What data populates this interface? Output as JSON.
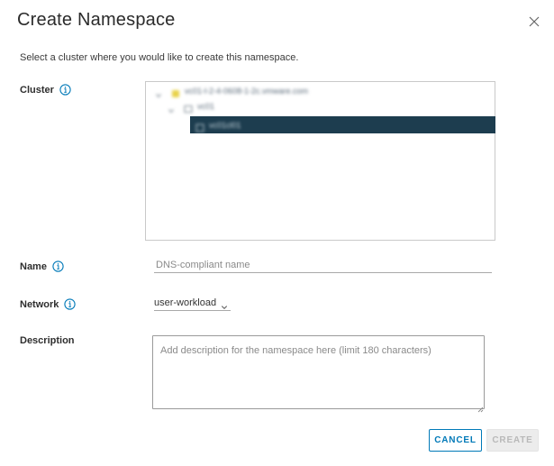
{
  "dialog": {
    "title": "Create Namespace",
    "subtitle": "Select a cluster where you would like to create this namespace."
  },
  "cluster": {
    "label": "Cluster",
    "tree": [
      {
        "level": 0,
        "label": "vc01-l-2-4-0608-1-2c.vmware.com",
        "icon": "datacenter-icon",
        "expanded": true,
        "selected": false
      },
      {
        "level": 1,
        "label": "vc01",
        "icon": "folder-icon",
        "expanded": true,
        "selected": false
      },
      {
        "level": 2,
        "label": "vc01cl01",
        "icon": "cluster-icon",
        "expanded": false,
        "selected": true
      }
    ]
  },
  "name": {
    "label": "Name",
    "value": "",
    "placeholder": "DNS-compliant name"
  },
  "network": {
    "label": "Network",
    "selected": "user-workload"
  },
  "description": {
    "label": "Description",
    "value": "",
    "placeholder": "Add description for the namespace here (limit 180 characters)"
  },
  "actions": {
    "cancel_label": "CANCEL",
    "create_label": "CREATE",
    "create_enabled": false
  },
  "colors": {
    "accent": "#0079b8",
    "selected_row": "#1d3d4f",
    "disabled_bg": "#ececec"
  }
}
